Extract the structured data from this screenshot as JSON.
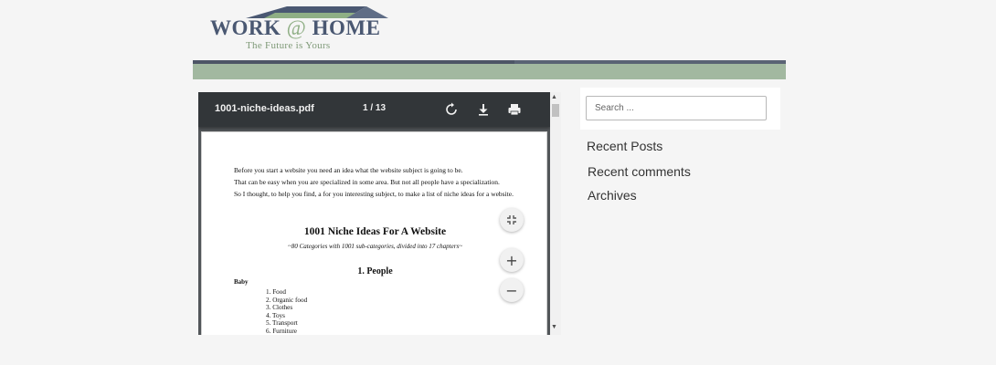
{
  "logo": {
    "title_left": "WORK ",
    "title_at": "@",
    "title_right": " HOME",
    "tagline": "The Future is Yours",
    "colors": {
      "primary": "#4a5872",
      "accent": "#8faf85"
    }
  },
  "nav": {
    "color": "#a2b8a0",
    "border_color": "#4d5566"
  },
  "pdf": {
    "filename": "1001-niche-ideas.pdf",
    "page_current": "1",
    "page_separator": "/",
    "page_total": "13",
    "toolbar_icons": [
      "rotate-icon",
      "download-icon",
      "print-icon"
    ],
    "content": {
      "intro": [
        "Before you start a website you need an idea what the website subject is going to be.",
        "That can be easy when you are specialized in some area. But not all people have a specialization.",
        "So I thought, to help you find, a for you interesting subject, to make a list of niche ideas for a website."
      ],
      "title": "1001 Niche Ideas For A Website",
      "subtitle": "~80 Categories with 1001 sub-categories, divided into 17 chapters~",
      "section": "1. People",
      "subsection": "Baby",
      "items": [
        "1.  Food",
        "2.  Organic food",
        "3.  Clothes",
        "4.  Toys",
        "5.  Transport",
        "6.  Furniture"
      ]
    },
    "zoom": {
      "fit": "fit-page-icon",
      "in": "+",
      "out": "−"
    }
  },
  "sidebar": {
    "search_placeholder": "Search ...",
    "widgets": [
      "Recent Posts",
      "Recent comments",
      "Archives"
    ]
  }
}
